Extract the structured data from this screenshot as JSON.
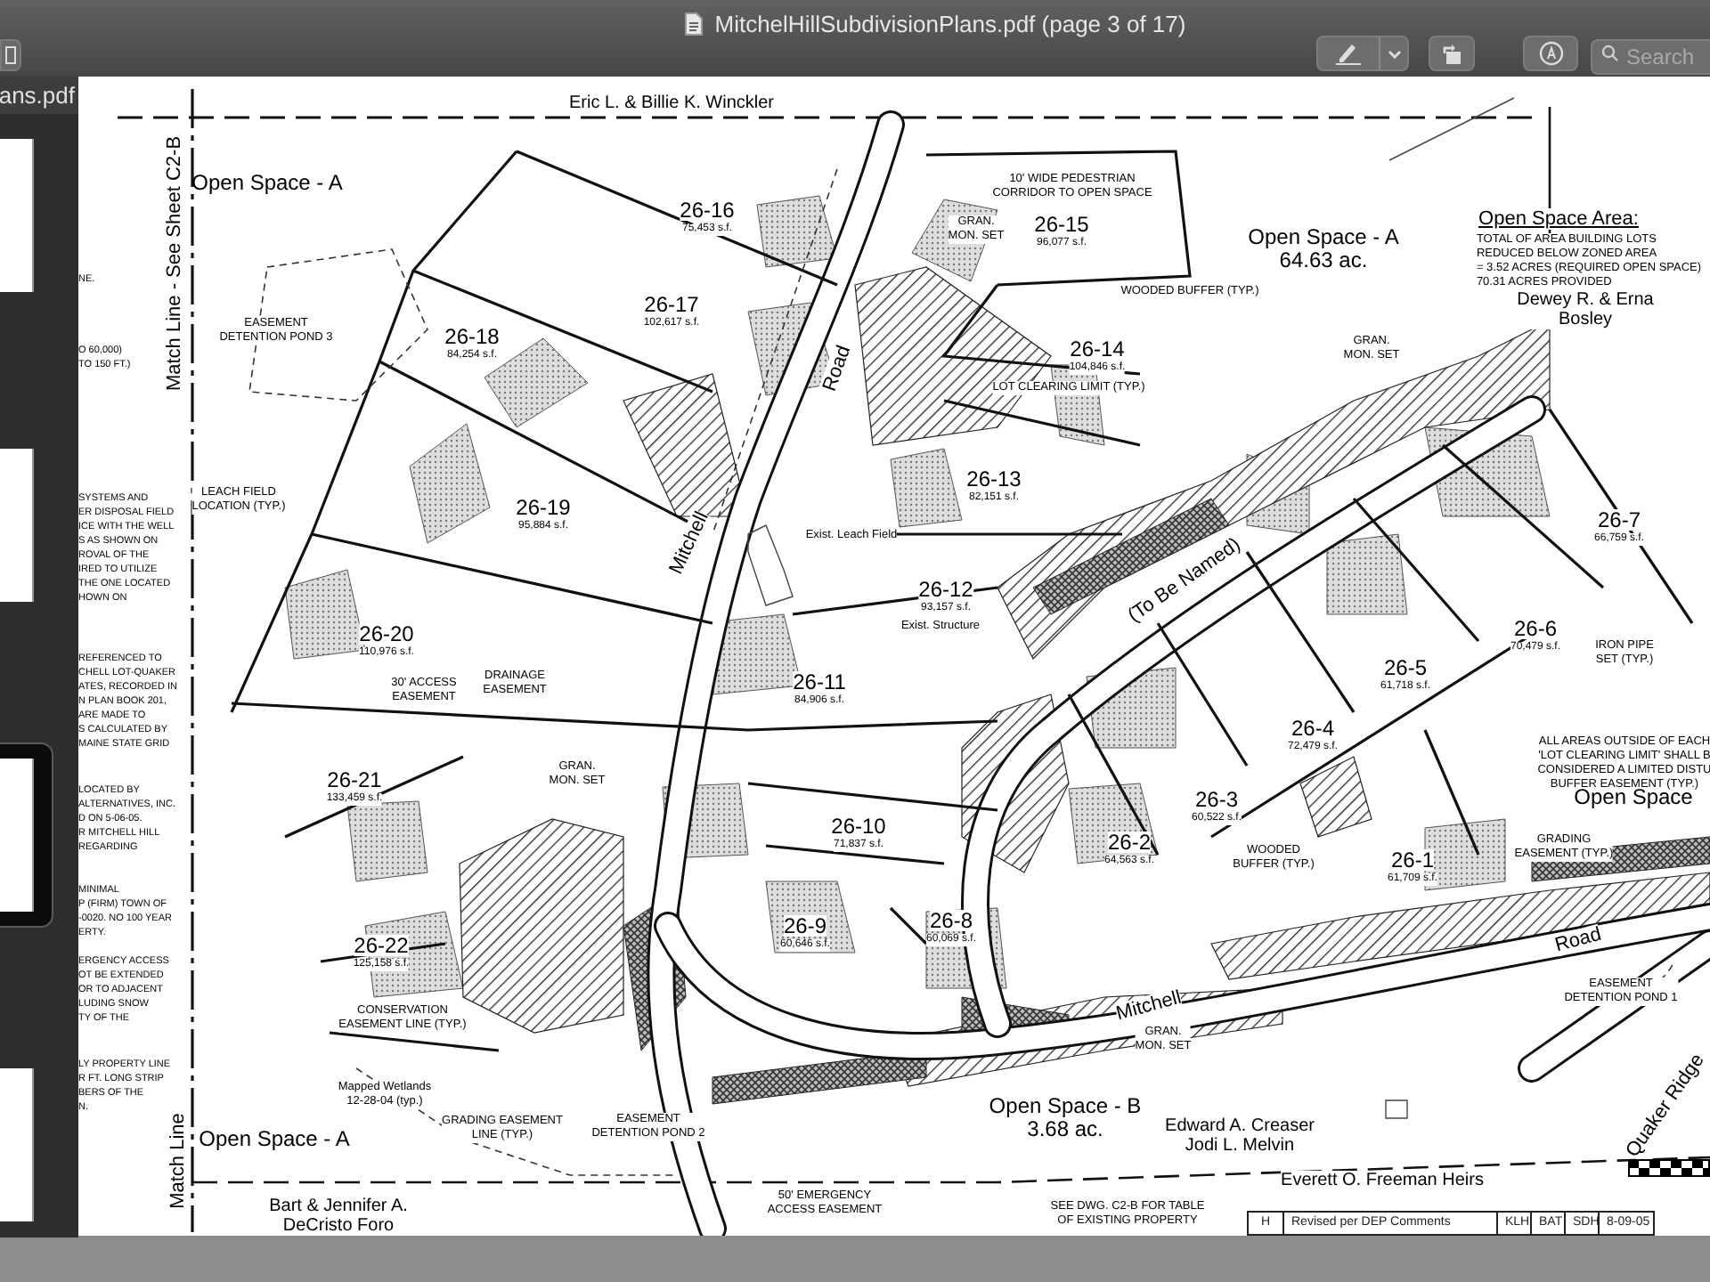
{
  "window": {
    "title": "MitchelHillSubdivisionPlans.pdf (page 3 of 17)"
  },
  "toolbar": {
    "search": {
      "placeholder": "Search"
    }
  },
  "sidebar": {
    "file_name": "ans.pdf",
    "pages": [
      {
        "selected": false
      },
      {
        "selected": false
      },
      {
        "selected": true
      },
      {
        "selected": false
      }
    ]
  },
  "plan": {
    "lots": [
      {
        "number": "26-16",
        "area": "75,453 s.f."
      },
      {
        "number": "26-15",
        "area": "96,077 s.f."
      },
      {
        "number": "26-17",
        "area": "102,617 s.f."
      },
      {
        "number": "26-14",
        "area": "104,846 s.f."
      },
      {
        "number": "26-18",
        "area": "84,254 s.f."
      },
      {
        "number": "26-13",
        "area": "82,151 s.f."
      },
      {
        "number": "26-19",
        "area": "95,884 s.f."
      },
      {
        "number": "26-12",
        "area": "93,157 s.f."
      },
      {
        "number": "26-20",
        "area": "110,976 s.f."
      },
      {
        "number": "26-11",
        "area": "84,906 s.f."
      },
      {
        "number": "26-7",
        "area": "66,759 s.f."
      },
      {
        "number": "26-6",
        "area": "70,479 s.f."
      },
      {
        "number": "26-5",
        "area": "61,718 s.f."
      },
      {
        "number": "26-4",
        "area": "72,479 s.f."
      },
      {
        "number": "26-3",
        "area": "60,522 s.f."
      },
      {
        "number": "26-21",
        "area": "133,459 s.f."
      },
      {
        "number": "26-10",
        "area": "71,837 s.f."
      },
      {
        "number": "26-2",
        "area": "64,563 s.f."
      },
      {
        "number": "26-1",
        "area": "61,709 s.f."
      },
      {
        "number": "26-9",
        "area": "60,646 s.f."
      },
      {
        "number": "26-8",
        "area": "60,069 s.f."
      },
      {
        "number": "26-22",
        "area": "125,158 s.f."
      }
    ],
    "labels": [
      {
        "kind": "area",
        "lines": [
          "Open Space - A"
        ]
      },
      {
        "kind": "area",
        "lines": [
          "Open Space - A",
          "64.63 ac."
        ]
      },
      {
        "kind": "heading",
        "lines": [
          "Open Space Area:"
        ]
      },
      {
        "kind": "note",
        "lines": [
          "TOTAL OF AREA BUILDING LOTS",
          "REDUCED BELOW ZONED AREA",
          "= 3.52 ACRES (REQUIRED OPEN SPACE)",
          "70.31 ACRES PROVIDED"
        ]
      },
      {
        "kind": "owner",
        "lines": [
          "Eric L. & Billie K. Winckler"
        ]
      },
      {
        "kind": "owner",
        "lines": [
          "Dewey R. & Erna",
          "Bosley"
        ]
      },
      {
        "kind": "road",
        "lines": [
          "Match Line - See Sheet C2-B"
        ]
      },
      {
        "kind": "road",
        "lines": [
          "Match Line"
        ]
      },
      {
        "kind": "callout",
        "lines": [
          "EASEMENT",
          "DETENTION POND 3"
        ]
      },
      {
        "kind": "callout",
        "lines": [
          "LEACH FIELD",
          "LOCATION (TYP.)"
        ]
      },
      {
        "kind": "callout",
        "lines": [
          "10' WIDE PEDESTRIAN",
          "CORRIDOR TO OPEN SPACE"
        ]
      },
      {
        "kind": "callout",
        "lines": [
          "WOODED BUFFER (TYP.)"
        ]
      },
      {
        "kind": "callout",
        "lines": [
          "LOT CLEARING LIMIT (TYP.)"
        ]
      },
      {
        "kind": "road",
        "lines": [
          "Mitchell"
        ]
      },
      {
        "kind": "road",
        "lines": [
          "Road"
        ]
      },
      {
        "kind": "road",
        "lines": [
          "(To Be Named)"
        ]
      },
      {
        "kind": "callout",
        "lines": [
          "30' ACCESS",
          "EASEMENT"
        ]
      },
      {
        "kind": "callout",
        "lines": [
          "DRAINAGE",
          "EASEMENT"
        ]
      },
      {
        "kind": "callout",
        "lines": [
          "GRAN.",
          "MON. SET"
        ]
      },
      {
        "kind": "callout",
        "lines": [
          "GRAN.",
          "MON. SET"
        ]
      },
      {
        "kind": "callout",
        "lines": [
          "GRAN.",
          "MON. SET"
        ]
      },
      {
        "kind": "callout",
        "lines": [
          "GRAN.",
          "MON. SET"
        ]
      },
      {
        "kind": "callout",
        "lines": [
          "IRON PIPE",
          "SET (TYP.)"
        ]
      },
      {
        "kind": "callout",
        "lines": [
          "ALL AREAS OUTSIDE OF EACH",
          "'LOT CLEARING LIMIT' SHALL B",
          "CONSIDERED A LIMITED DISTU",
          "BUFFER EASEMENT (TYP.)"
        ]
      },
      {
        "kind": "callout",
        "lines": [
          "WOODED",
          "BUFFER (TYP.)"
        ]
      },
      {
        "kind": "callout",
        "lines": [
          "GRADING",
          "EASEMENT (TYP.)"
        ]
      },
      {
        "kind": "callout",
        "lines": [
          "EASEMENT",
          "DETENTION POND 1"
        ]
      },
      {
        "kind": "road",
        "lines": [
          "Quaker Ridge"
        ]
      },
      {
        "kind": "road",
        "lines": [
          "Mitchell"
        ]
      },
      {
        "kind": "road",
        "lines": [
          "Road"
        ]
      },
      {
        "kind": "area",
        "lines": [
          "Open Space - B",
          "3.68 ac."
        ]
      },
      {
        "kind": "area",
        "lines": [
          "Open Space"
        ]
      },
      {
        "kind": "callout",
        "lines": [
          "CONSERVATION",
          "EASEMENT LINE (TYP.)"
        ]
      },
      {
        "kind": "callout",
        "lines": [
          "Mapped Wetlands",
          "12-28-04 (typ.)"
        ]
      },
      {
        "kind": "callout",
        "lines": [
          "GRADING EASEMENT",
          "LINE (TYP.)"
        ]
      },
      {
        "kind": "callout",
        "lines": [
          "EASEMENT",
          "DETENTION POND 2"
        ]
      },
      {
        "kind": "area",
        "lines": [
          "Open Space - A"
        ]
      },
      {
        "kind": "owner",
        "lines": [
          "Bart & Jennifer A.",
          "DeCristo Foro"
        ]
      },
      {
        "kind": "callout",
        "lines": [
          "50' EMERGENCY",
          "ACCESS EASEMENT"
        ]
      },
      {
        "kind": "owner",
        "lines": [
          "Edward A. Creaser",
          "Jodi L. Melvin"
        ]
      },
      {
        "kind": "owner",
        "lines": [
          "Everett O. Freeman Heirs"
        ]
      },
      {
        "kind": "callout",
        "lines": [
          "SEE DWG. C2-B FOR TABLE",
          "OF EXISTING PROPERTY"
        ]
      },
      {
        "kind": "callout",
        "lines": [
          "Exist. Leach Field"
        ]
      },
      {
        "kind": "callout",
        "lines": [
          "Exist. Structure"
        ]
      }
    ],
    "left_notes": [
      {
        "lines": [
          "NE."
        ]
      },
      {
        "lines": [
          "O 60,000)",
          "TO 150 FT.)"
        ]
      },
      {
        "lines": [
          "SYSTEMS AND",
          "ER DISPOSAL FIELD",
          "ICE WITH THE WELL",
          "S AS SHOWN ON",
          "ROVAL OF THE",
          "IRED TO UTILIZE",
          "THE ONE LOCATED",
          "HOWN ON"
        ]
      },
      {
        "lines": [
          "REFERENCED TO",
          "CHELL LOT-QUAKER",
          "ATES, RECORDED IN",
          "N PLAN BOOK 201,",
          "ARE MADE TO",
          "S CALCULATED BY",
          "MAINE STATE GRID"
        ]
      },
      {
        "lines": [
          "LOCATED BY",
          "ALTERNATIVES, INC.",
          "D ON 5-06-05.",
          "R MITCHELL HILL",
          "REGARDING"
        ]
      },
      {
        "lines": [
          "MINIMAL",
          "P (FIRM) TOWN OF",
          "-0020. NO 100 YEAR",
          "ERTY."
        ]
      },
      {
        "lines": [
          "ERGENCY ACCESS",
          "OT BE EXTENDED",
          "OR TO ADJACENT",
          "LUDING SNOW",
          "TY OF THE"
        ]
      },
      {
        "lines": [
          "LY PROPERTY LINE",
          "R FT. LONG STRIP",
          "BERS OF THE",
          "N."
        ]
      }
    ],
    "revision": {
      "mark": "H",
      "description": "Revised per DEP Comments",
      "initials": [
        "KLH",
        "BAT",
        "SDH"
      ],
      "date": "8-09-05"
    }
  }
}
